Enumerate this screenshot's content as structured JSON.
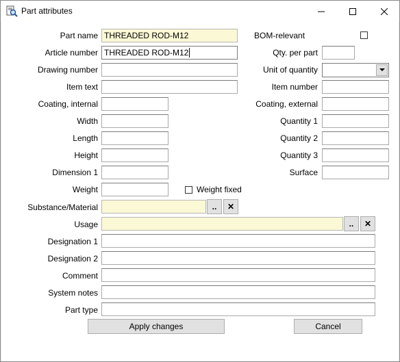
{
  "window": {
    "title": "Part attributes"
  },
  "form": {
    "part_name": {
      "label": "Part name",
      "value": "THREADED ROD-M12"
    },
    "article_number": {
      "label": "Article number",
      "value": "THREADED ROD-M12"
    },
    "drawing_number": {
      "label": "Drawing number",
      "value": ""
    },
    "item_text": {
      "label": "Item text",
      "value": ""
    },
    "coating_internal": {
      "label": "Coating, internal",
      "value": ""
    },
    "width": {
      "label": "Width",
      "value": ""
    },
    "length": {
      "label": "Length",
      "value": ""
    },
    "height": {
      "label": "Height",
      "value": ""
    },
    "dimension1": {
      "label": "Dimension 1",
      "value": ""
    },
    "weight": {
      "label": "Weight",
      "value": ""
    },
    "weight_fixed": {
      "label": "Weight fixed",
      "checked": false
    },
    "substance": {
      "label": "Substance/Material",
      "value": ""
    },
    "usage": {
      "label": "Usage",
      "value": ""
    },
    "designation1": {
      "label": "Designation 1",
      "value": ""
    },
    "designation2": {
      "label": "Designation 2",
      "value": ""
    },
    "comment": {
      "label": "Comment",
      "value": ""
    },
    "system_notes": {
      "label": "System notes",
      "value": ""
    },
    "part_type": {
      "label": "Part type",
      "value": ""
    },
    "bom_relevant": {
      "label": "BOM-relevant",
      "checked": false
    },
    "qty_per_part": {
      "label": "Qty. per part",
      "value": ""
    },
    "unit_of_quantity": {
      "label": "Unit of quantity",
      "value": ""
    },
    "item_number": {
      "label": "Item number",
      "value": ""
    },
    "coating_external": {
      "label": "Coating, external",
      "value": ""
    },
    "quantity1": {
      "label": "Quantity 1",
      "value": ""
    },
    "quantity2": {
      "label": "Quantity 2",
      "value": ""
    },
    "quantity3": {
      "label": "Quantity 3",
      "value": ""
    },
    "surface": {
      "label": "Surface",
      "value": ""
    }
  },
  "buttons": {
    "browse": "..",
    "clear": "✕",
    "apply": "Apply changes",
    "cancel": "Cancel"
  }
}
